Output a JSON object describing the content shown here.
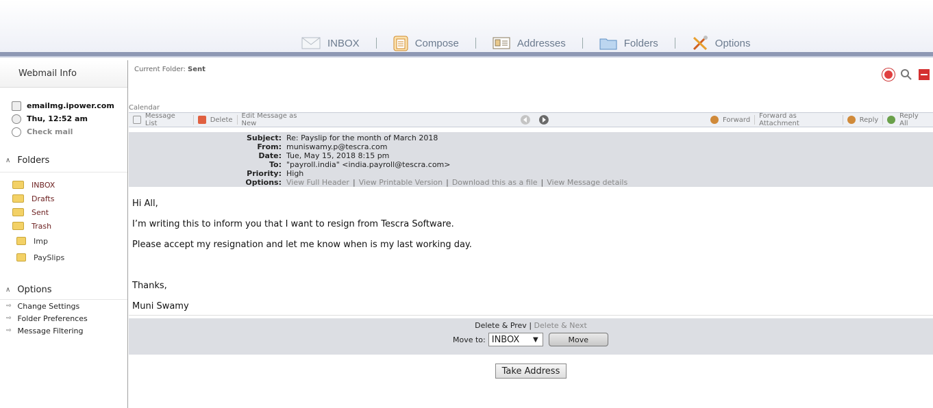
{
  "nav": {
    "items": [
      {
        "label": "INBOX",
        "icon": "envelope-icon"
      },
      {
        "label": "Compose",
        "icon": "clipboard-icon"
      },
      {
        "label": "Addresses",
        "icon": "address-card-icon"
      },
      {
        "label": "Folders",
        "icon": "folder-icon"
      },
      {
        "label": "Options",
        "icon": "tools-icon"
      }
    ]
  },
  "sidebar": {
    "title": "Webmail Info",
    "server": "emailmg.ipower.com",
    "datetime": "Thu, 12:52 am",
    "check_mail": "Check mail",
    "folders_title": "Folders",
    "folders": [
      "INBOX",
      "Drafts",
      "Sent",
      "Trash",
      "Imp",
      "PaySlips"
    ],
    "options_title": "Options",
    "options": [
      "Change Settings",
      "Folder Preferences",
      "Message Filtering"
    ]
  },
  "main": {
    "current_folder_label": "Current Folder:",
    "current_folder": "Sent",
    "calendar": "Calendar"
  },
  "toolbar": {
    "message_list": "Message List",
    "delete": "Delete",
    "edit_as_new": "Edit Message as New",
    "forward": "Forward",
    "forward_attachment": "Forward as Attachment",
    "reply": "Reply",
    "reply_all": "Reply All"
  },
  "header": {
    "subject_label": "Subject:",
    "subject": "Re: Payslip for the month of March 2018",
    "from_label": "From:",
    "from": "muniswamy.p@tescra.com",
    "date_label": "Date:",
    "date": "Tue, May 15, 2018 8:15 pm",
    "to_label": "To:",
    "to": "\"payroll.india\" <india.payroll@tescra.com>",
    "priority_label": "Priority:",
    "priority": "High",
    "options_label": "Options:",
    "options": [
      "View Full Header",
      "View Printable Version",
      "Download this as a file",
      "View Message details"
    ]
  },
  "body": {
    "lines": [
      "Hi All,",
      "I’m writing this to inform you that I want to resign from Tescra Software.",
      "Please accept my resignation and let me know when is my last working day.",
      "",
      "Thanks,",
      "Muni Swamy"
    ]
  },
  "bottom": {
    "delete_prev": "Delete & Prev",
    "delete_next": "Delete & Next",
    "move_to_label": "Move to:",
    "move_to_value": "INBOX",
    "move_button": "Move",
    "take_address": "Take Address"
  }
}
